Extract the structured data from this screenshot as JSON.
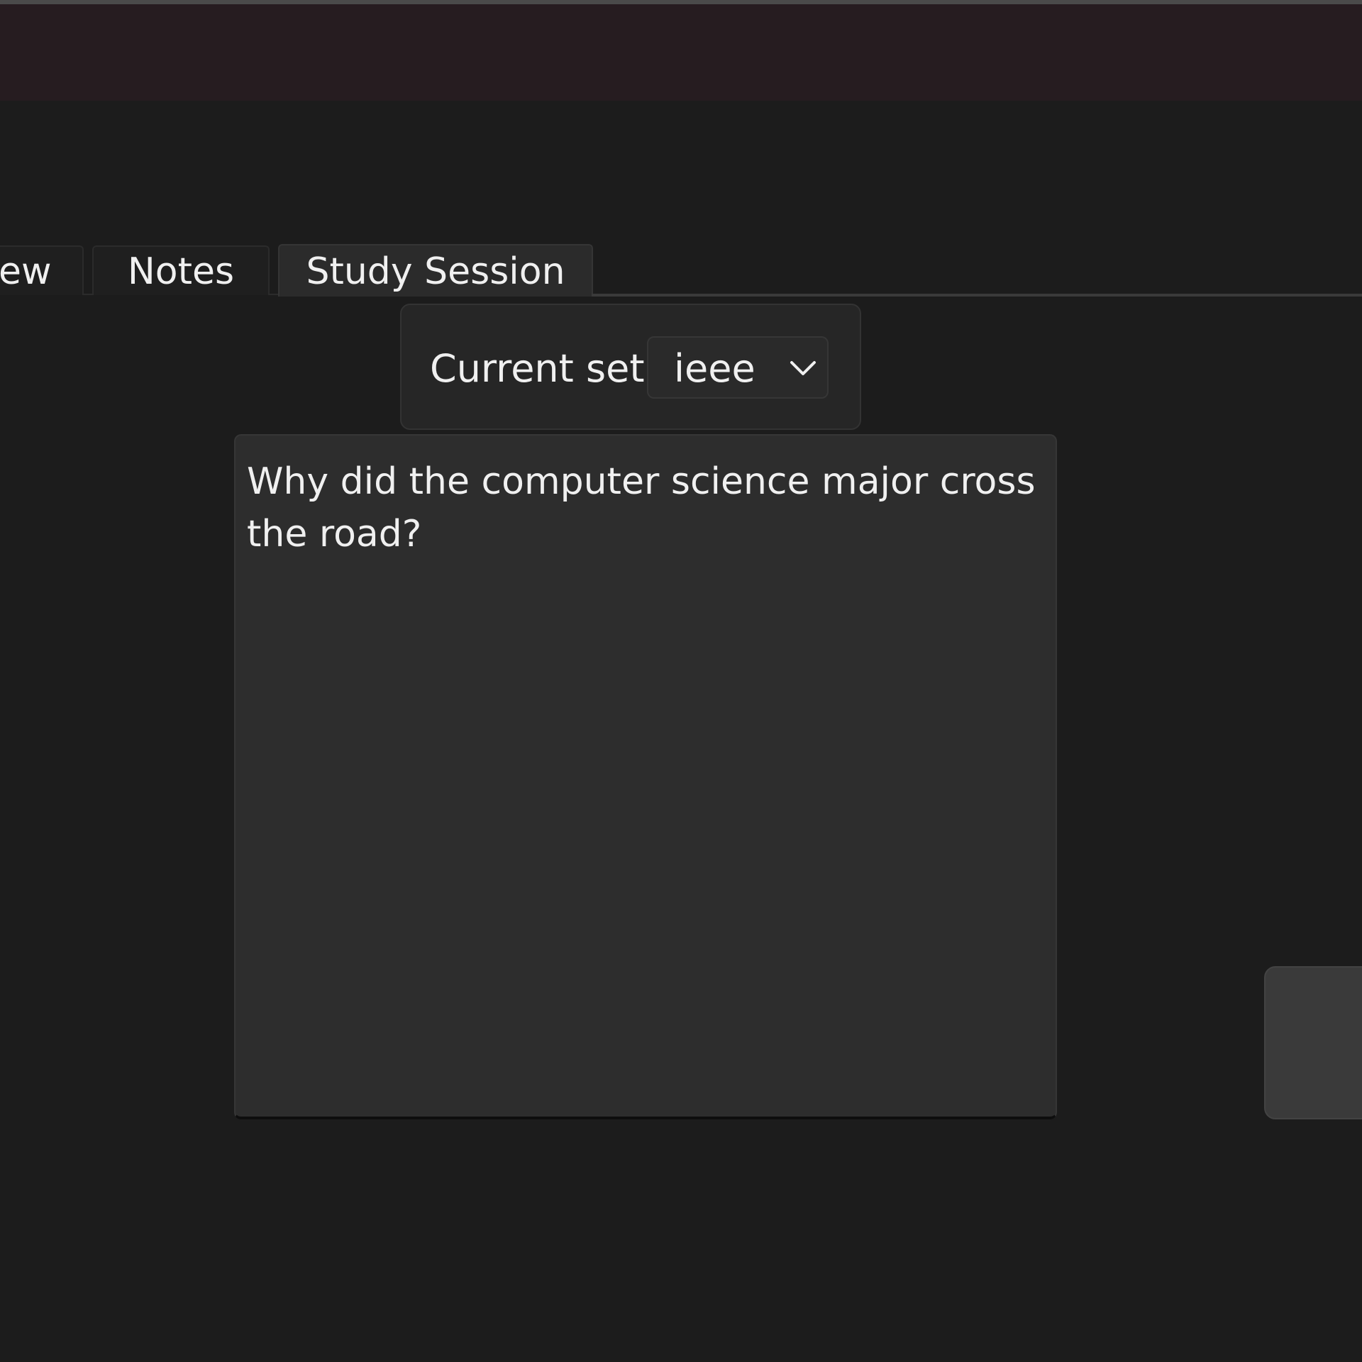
{
  "tabs": [
    {
      "label": "ew"
    },
    {
      "label": "Notes"
    },
    {
      "label": "Study Session"
    }
  ],
  "set_selector": {
    "label": "Current set",
    "value": "ieee"
  },
  "card": {
    "text": "Why did the computer science major cross the road?"
  },
  "colors": {
    "background": "#1c1c1c",
    "titlebar": "#261c20",
    "panel": "#2d2d2d",
    "text": "#f0f0f0"
  },
  "icons": {
    "dropdown": "chevron-down-icon"
  }
}
